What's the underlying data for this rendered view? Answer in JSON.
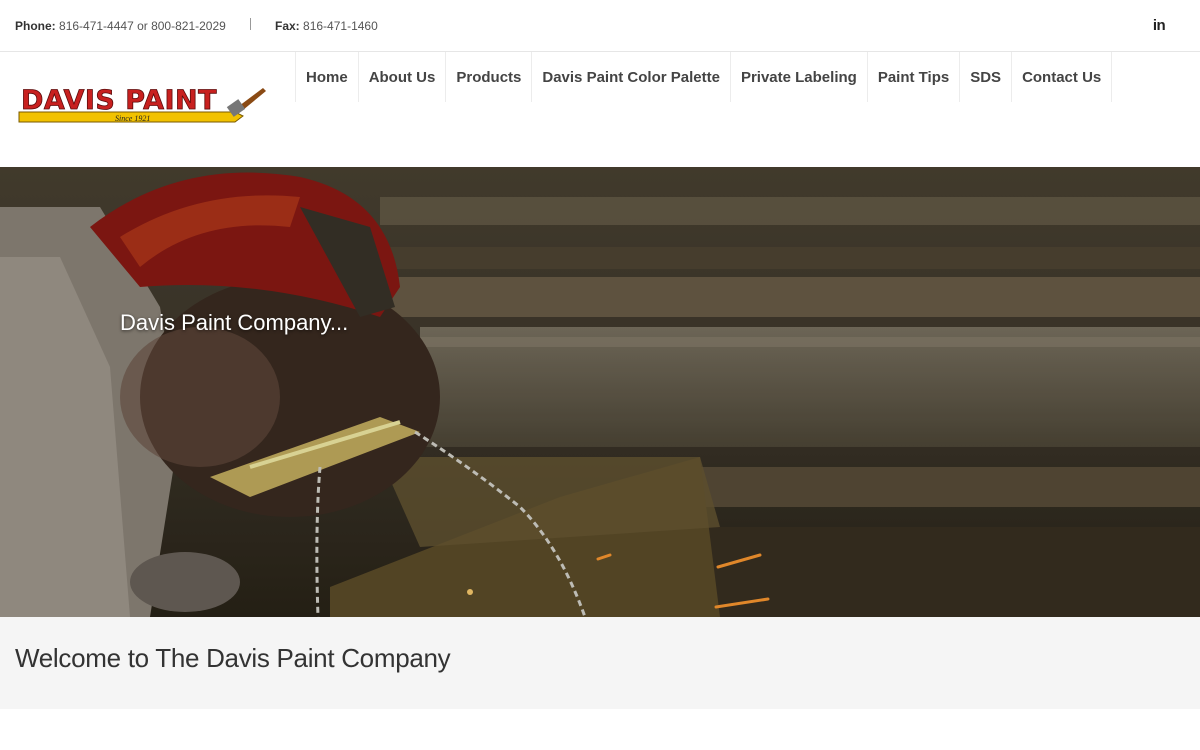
{
  "topbar": {
    "phone_label": "Phone:",
    "phone_value": "816-471-4447 or 800-821-2029",
    "fax_label": "Fax:",
    "fax_value": "816-471-1460",
    "social_icon": "linkedin-icon",
    "social_text": "in"
  },
  "logo": {
    "brand": "DAVIS PAINT",
    "tagline": "Since 1921",
    "colors": {
      "red": "#c8201f",
      "yellow": "#f2c200"
    }
  },
  "nav": {
    "items": [
      {
        "label": "Home"
      },
      {
        "label": "About Us"
      },
      {
        "label": "Products"
      },
      {
        "label": "Davis Paint Color Palette"
      },
      {
        "label": "Private Labeling"
      },
      {
        "label": "Paint Tips"
      },
      {
        "label": "SDS"
      },
      {
        "label": "Contact Us"
      }
    ]
  },
  "hero": {
    "caption": "Davis Paint Company..."
  },
  "welcome": {
    "heading": "Welcome to The Davis Paint Company"
  }
}
